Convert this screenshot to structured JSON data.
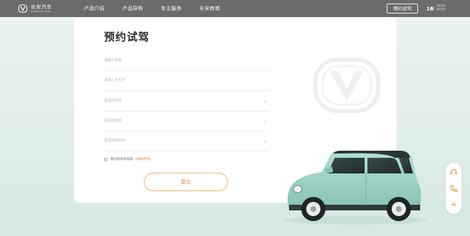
{
  "brand": {
    "name_cn": "长安汽车",
    "name_en": "CHANGAN AUTO",
    "logo_icon": "changan-v-logo-icon"
  },
  "nav": {
    "items": [
      {
        "label": "产品介绍"
      },
      {
        "label": "产品导购"
      },
      {
        "label": "车主服务"
      },
      {
        "label": "长安商城"
      }
    ],
    "cta_label": "预约试驾",
    "badge_icon": "anniversary-badge-icon",
    "slogan_line1": "科技长安",
    "slogan_line2": "智慧长安"
  },
  "form": {
    "title": "预约试驾",
    "fields": [
      {
        "placeholder": "请输入姓名",
        "type": "text"
      },
      {
        "placeholder": "请输入手机号",
        "type": "text"
      },
      {
        "placeholder": "请选择省份",
        "type": "select"
      },
      {
        "placeholder": "请选择城市",
        "type": "select"
      },
      {
        "placeholder": "请选择经销商",
        "type": "select"
      }
    ],
    "agreement_text": "我已阅读并同意",
    "agreement_link": "《隐私政策》",
    "submit_label": "提交"
  },
  "floatbar": {
    "icons": [
      "headset-icon",
      "phone-icon",
      "back-to-top-icon"
    ]
  },
  "colors": {
    "nav_bg": "#6b6b6b",
    "accent": "#e08a2b",
    "page_bg": "#e3efe9",
    "car_body": "#9fd3c7"
  }
}
